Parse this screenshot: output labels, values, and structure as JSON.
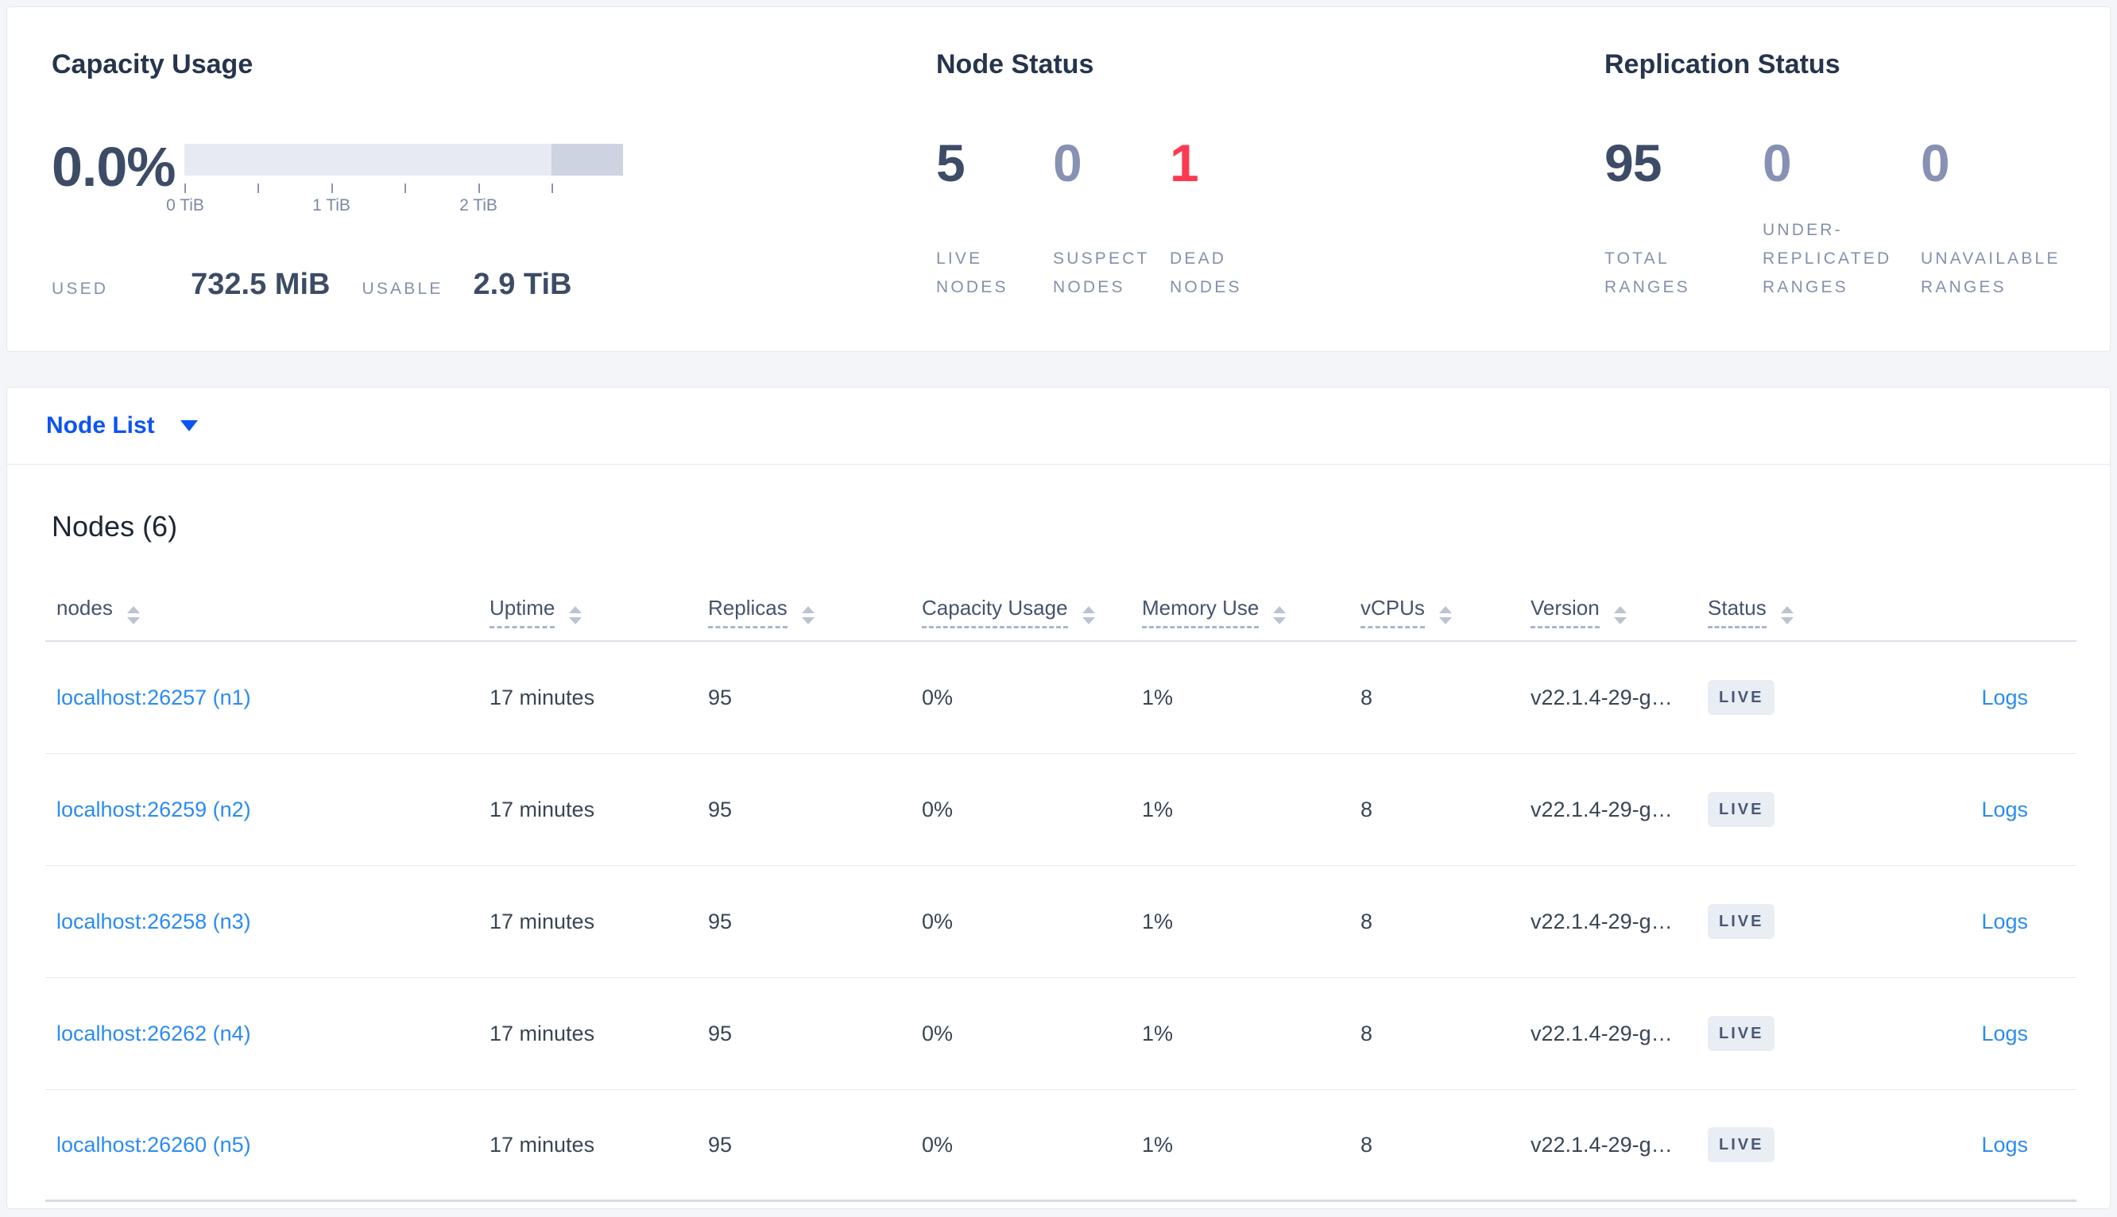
{
  "summary": {
    "capacity": {
      "title": "Capacity Usage",
      "percent": "0.0%",
      "used_label": "USED",
      "used_value": "732.5 MiB",
      "usable_label": "USABLE",
      "usable_value": "2.9 TiB",
      "axis_ticks": [
        "0 TiB",
        "1 TiB",
        "2 TiB"
      ]
    },
    "node_status": {
      "title": "Node Status",
      "stats": [
        {
          "value": "5",
          "label": "LIVE NODES"
        },
        {
          "value": "0",
          "label": "SUSPECT NODES"
        },
        {
          "value": "1",
          "label": "DEAD NODES"
        }
      ]
    },
    "replication_status": {
      "title": "Replication Status",
      "stats": [
        {
          "value": "95",
          "label": "TOTAL RANGES"
        },
        {
          "value": "0",
          "label": "UNDER-REPLICATED RANGES"
        },
        {
          "value": "0",
          "label": "UNAVAILABLE RANGES"
        }
      ]
    }
  },
  "view_selector": {
    "label": "Node List"
  },
  "nodes_table": {
    "title": "Nodes (6)",
    "logs_label": "Logs",
    "columns": [
      {
        "label": "nodes"
      },
      {
        "label": "Uptime"
      },
      {
        "label": "Replicas"
      },
      {
        "label": "Capacity Usage"
      },
      {
        "label": "Memory Use"
      },
      {
        "label": "vCPUs"
      },
      {
        "label": "Version"
      },
      {
        "label": "Status"
      }
    ],
    "rows": [
      {
        "address": "localhost:26257 (n1)",
        "uptime": "17 minutes",
        "replicas": "95",
        "capacity_usage": "0%",
        "memory_use": "1%",
        "vcpus": "8",
        "version": "v22.1.4-29-g…",
        "status": "LIVE"
      },
      {
        "address": "localhost:26259 (n2)",
        "uptime": "17 minutes",
        "replicas": "95",
        "capacity_usage": "0%",
        "memory_use": "1%",
        "vcpus": "8",
        "version": "v22.1.4-29-g…",
        "status": "LIVE"
      },
      {
        "address": "localhost:26258 (n3)",
        "uptime": "17 minutes",
        "replicas": "95",
        "capacity_usage": "0%",
        "memory_use": "1%",
        "vcpus": "8",
        "version": "v22.1.4-29-g…",
        "status": "LIVE"
      },
      {
        "address": "localhost:26262 (n4)",
        "uptime": "17 minutes",
        "replicas": "95",
        "capacity_usage": "0%",
        "memory_use": "1%",
        "vcpus": "8",
        "version": "v22.1.4-29-g…",
        "status": "LIVE"
      },
      {
        "address": "localhost:26260 (n5)",
        "uptime": "17 minutes",
        "replicas": "95",
        "capacity_usage": "0%",
        "memory_use": "1%",
        "vcpus": "8",
        "version": "v22.1.4-29-g…",
        "status": "LIVE"
      }
    ]
  },
  "colors": {
    "accent_blue": "#0c55f0",
    "link_blue": "#2b8bf2",
    "danger_red": "#fb3a52",
    "muted_slate": "#8691b3",
    "dark_slate": "#3d4c66",
    "badge_bg": "#e9edf4",
    "page_bg": "#f3f5f9"
  }
}
